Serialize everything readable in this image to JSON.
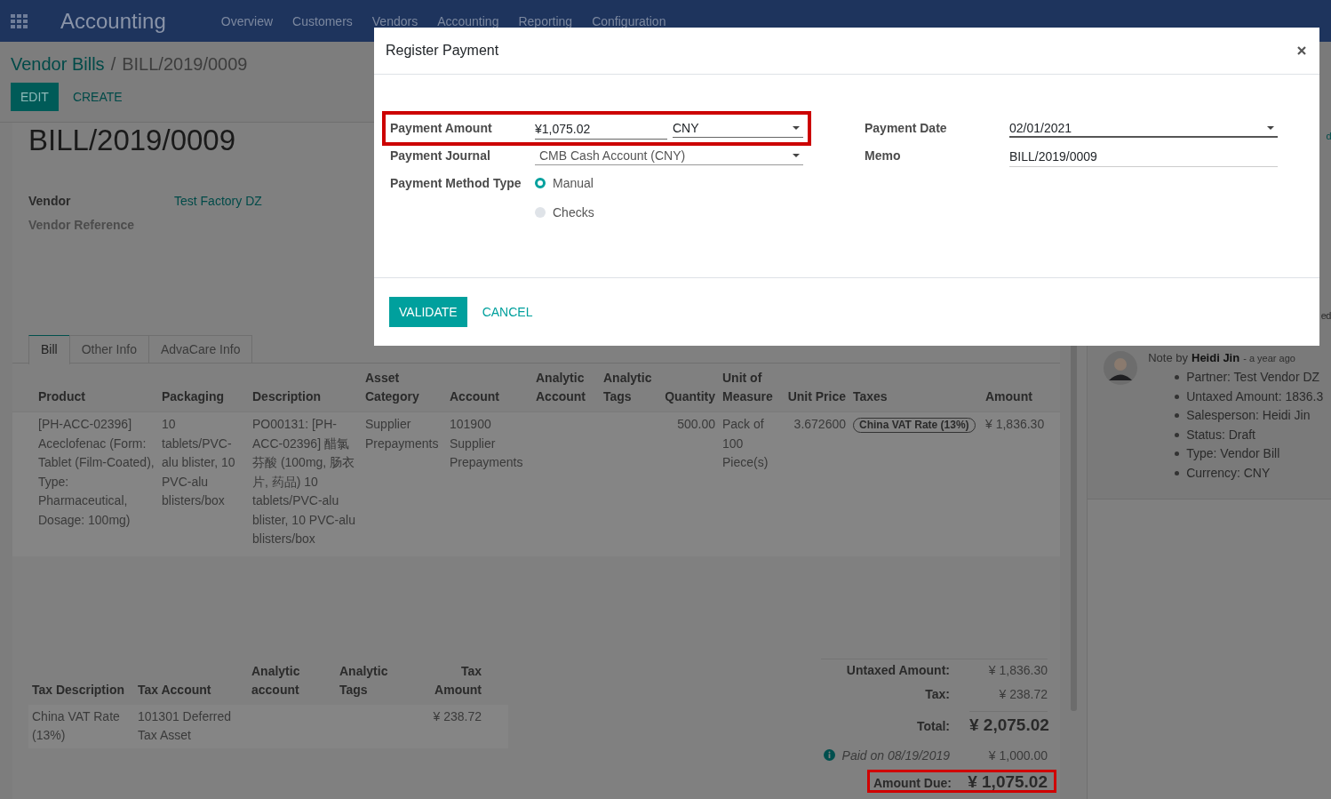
{
  "navbar": {
    "app_title": "Accounting",
    "menu": [
      "Overview",
      "Customers",
      "Vendors",
      "Accounting",
      "Reporting",
      "Configuration"
    ]
  },
  "breadcrumb": {
    "parent": "Vendor Bills",
    "separator": "/",
    "current": "BILL/2019/0009"
  },
  "buttons": [
    {
      "label": "EDIT",
      "kind": "primary"
    },
    {
      "label": "CREATE",
      "kind": "link"
    }
  ],
  "bill": {
    "title": "BILL/2019/0009",
    "fields": [
      {
        "label": "Vendor",
        "value": "Test Factory DZ"
      },
      {
        "label": "Vendor Reference"
      }
    ]
  },
  "tabs": [
    {
      "label": "Bill",
      "selected": true
    },
    {
      "label": "Other Info",
      "selected": false
    },
    {
      "label": "AdvaCare Info",
      "selected": false
    }
  ],
  "lines_table": {
    "columns": [
      "Product",
      "Packaging",
      "Description",
      "Asset Category",
      "Account",
      "Analytic Account",
      "Analytic Tags",
      "Quantity",
      "Unit of Measure",
      "Unit Price",
      "Taxes",
      "Amount"
    ],
    "rows": [
      {
        "cells": [
          "[PH-ACC-02396] Aceclofenac (Form: Tablet (Film-Coated), Type: Pharmaceutical, Dosage: 100mg)",
          "10 tablets/PVC-alu blister, 10 PVC-alu blisters/box",
          "PO00131: [PH-ACC-02396] 醋氯芬酸 (100mg, 肠衣片, 药品) 10 tablets/PVC-alu blister, 10 PVC-alu blisters/box",
          "Supplier Prepayments",
          "101900 Supplier Prepayments",
          "",
          "",
          "500.00",
          "Pack of 100 Piece(s)",
          "3.672600",
          "",
          "¥ 1,836.30"
        ],
        "tax_tags": [
          "China VAT Rate (13%)"
        ]
      }
    ]
  },
  "tax_table": {
    "columns": [
      "Tax Description",
      "Tax Account",
      "Analytic account",
      "Analytic Tags",
      "Tax Amount"
    ],
    "rows": [
      [
        "China VAT Rate (13%)",
        "101301 Deferred Tax Asset",
        "",
        "",
        "¥ 238.72"
      ]
    ]
  },
  "totals": [
    {
      "label": "Untaxed Amount:",
      "value": "¥ 1,836.30",
      "kind": "normal",
      "highlighted": false
    },
    {
      "label": "Tax:",
      "value": "¥ 238.72",
      "kind": "normal",
      "highlighted": false
    },
    {
      "label": "Total:",
      "value": "¥ 2,075.02",
      "kind": "total",
      "highlighted": false
    },
    {
      "label": "Paid on 08/19/2019",
      "value": "¥ 1,000.00",
      "kind": "payment",
      "highlighted": false
    },
    {
      "label": "Amount Due:",
      "value": "¥ 1,075.02",
      "kind": "due",
      "highlighted": true
    }
  ],
  "chatter": {
    "fragments": [
      "d",
      "ed"
    ],
    "note": {
      "prefix": "Note by",
      "author": "Heidi Jin",
      "time": "- a year ago",
      "items": [
        "Partner: Test Vendor DZ",
        "Untaxed Amount: 1836.3",
        "Salesperson: Heidi Jin",
        "Status: Draft",
        "Type: Vendor Bill",
        "Currency: CNY"
      ]
    }
  },
  "dialog": {
    "title": "Register Payment",
    "left_fields": [
      {
        "label": "Payment Amount",
        "kind": "amount",
        "value": "¥1,075.02",
        "currency": "CNY",
        "highlighted": true
      },
      {
        "label": "Payment Journal",
        "kind": "select",
        "value": "CMB Cash Account (CNY)",
        "highlighted": false
      },
      {
        "label": "Payment Method Type",
        "kind": "radio",
        "highlighted": false,
        "options": [
          {
            "label": "Manual",
            "selected": true
          },
          {
            "label": "Checks",
            "selected": false
          }
        ]
      }
    ],
    "right_fields": [
      {
        "label": "Payment Date",
        "kind": "select",
        "value": "02/01/2021",
        "highlighted": false
      },
      {
        "label": "Memo",
        "kind": "text",
        "value": "BILL/2019/0009",
        "highlighted": false
      }
    ],
    "buttons": [
      {
        "label": "VALIDATE",
        "kind": "primary"
      },
      {
        "label": "CANCEL",
        "kind": "link"
      }
    ]
  }
}
